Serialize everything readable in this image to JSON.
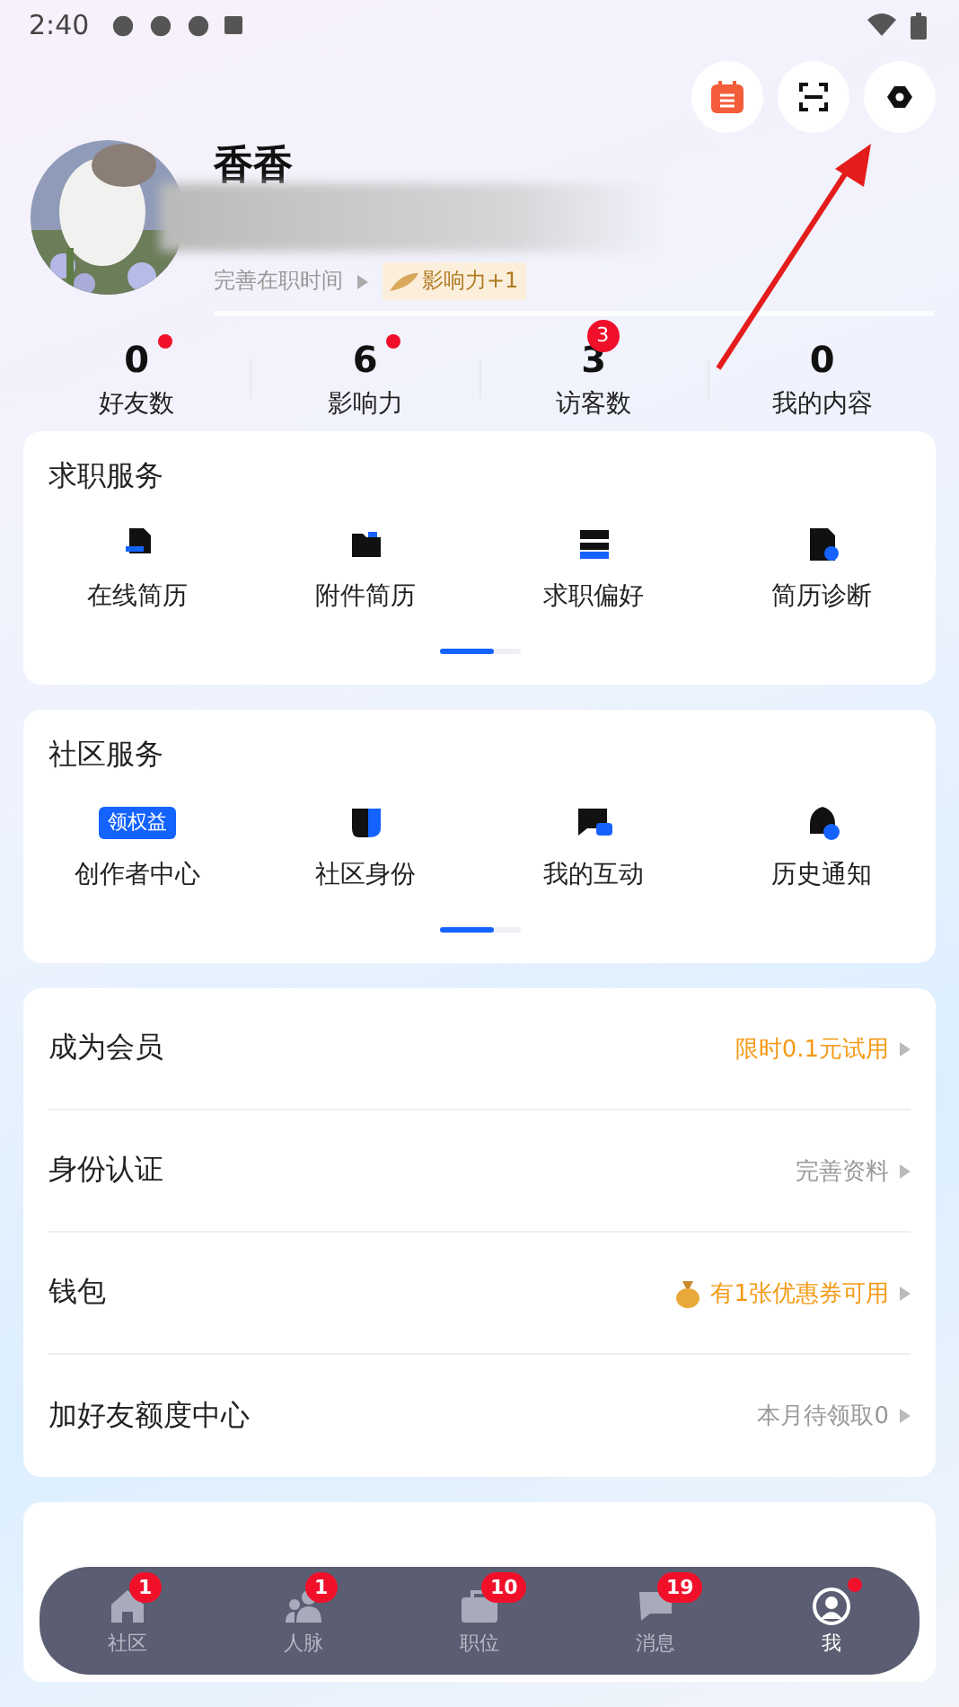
{
  "status_bar": {
    "time": "2:40"
  },
  "profile": {
    "name": "香香",
    "hint": "完善在职时间",
    "influence_tag": "影响力+1"
  },
  "stats": [
    {
      "value": "0",
      "label": "好友数",
      "dot": true
    },
    {
      "value": "6",
      "label": "影响力",
      "dot": true
    },
    {
      "value": "3",
      "label": "访客数",
      "dot": false,
      "badge": "3"
    },
    {
      "value": "0",
      "label": "我的内容",
      "dot": false
    }
  ],
  "job_services": {
    "title": "求职服务",
    "items": [
      {
        "label": "在线简历"
      },
      {
        "label": "附件简历"
      },
      {
        "label": "求职偏好"
      },
      {
        "label": "简历诊断"
      }
    ]
  },
  "community_services": {
    "title": "社区服务",
    "items": [
      {
        "label": "创作者中心",
        "tag": "领权益"
      },
      {
        "label": "社区身份"
      },
      {
        "label": "我的互动"
      },
      {
        "label": "历史通知"
      }
    ]
  },
  "menu": [
    {
      "label": "成为会员",
      "value": "限时0.1元试用",
      "kind": "highlight"
    },
    {
      "label": "身份认证",
      "value": "完善资料",
      "kind": "plain"
    },
    {
      "label": "钱包",
      "value": "有1张优惠券可用",
      "kind": "coupon"
    },
    {
      "label": "加好友额度中心",
      "value": "本月待领取0",
      "kind": "plain"
    }
  ],
  "bottom_nav": [
    {
      "label": "社区",
      "badge": "1",
      "dot": false,
      "selected": false
    },
    {
      "label": "人脉",
      "badge": "1",
      "dot": false,
      "selected": false
    },
    {
      "label": "职位",
      "badge": "10",
      "dot": false,
      "selected": false
    },
    {
      "label": "消息",
      "badge": "19",
      "dot": false,
      "selected": false
    },
    {
      "label": "我",
      "dot": true,
      "selected": true
    }
  ]
}
